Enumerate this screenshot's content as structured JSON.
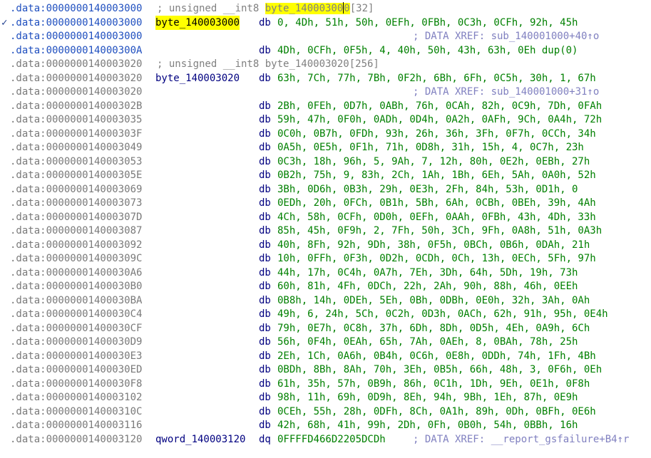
{
  "lines": [
    {
      "kind": "comment",
      "addr": ".data:0000000140003000",
      "text_pre": "; unsigned __int8 ",
      "hl": "byte_14000300",
      "hl_tail": "0",
      "text_post": "[32]",
      "addr_blue": true
    },
    {
      "kind": "data",
      "mark": "✓",
      "addr": ".data:0000000140003000",
      "label": "byte_140003000",
      "label_hl": true,
      "mnem": "db",
      "ops": "0, 4Dh, 51h, 50h, 0EFh, 0FBh, 0C3h, 0CFh, 92h, 45h",
      "addr_blue": true
    },
    {
      "kind": "xref",
      "addr": ".data:0000000140003000",
      "xref": "; DATA XREF: sub_140001000+40↑o",
      "addr_blue": true
    },
    {
      "kind": "data",
      "addr": ".data:000000014000300A",
      "mnem": "db",
      "ops": "4Dh, 0CFh, 0F5h, 4, 40h, 50h, 43h, 63h, 0Eh dup(0)",
      "addr_blue": true
    },
    {
      "kind": "comment",
      "addr": ".data:0000000140003020",
      "text_pre": "; unsigned __int8 byte_140003020[256]"
    },
    {
      "kind": "data",
      "addr": ".data:0000000140003020",
      "label": "byte_140003020",
      "mnem": "db",
      "ops": "63h, 7Ch, 77h, 7Bh, 0F2h, 6Bh, 6Fh, 0C5h, 30h, 1, 67h"
    },
    {
      "kind": "xref",
      "addr": ".data:0000000140003020",
      "xref": "; DATA XREF: sub_140001000+31↑o"
    },
    {
      "kind": "data",
      "addr": ".data:000000014000302B",
      "mnem": "db",
      "ops": "2Bh, 0FEh, 0D7h, 0ABh, 76h, 0CAh, 82h, 0C9h, 7Dh, 0FAh"
    },
    {
      "kind": "data",
      "addr": ".data:0000000140003035",
      "mnem": "db",
      "ops": "59h, 47h, 0F0h, 0ADh, 0D4h, 0A2h, 0AFh, 9Ch, 0A4h, 72h"
    },
    {
      "kind": "data",
      "addr": ".data:000000014000303F",
      "mnem": "db",
      "ops": "0C0h, 0B7h, 0FDh, 93h, 26h, 36h, 3Fh, 0F7h, 0CCh, 34h"
    },
    {
      "kind": "data",
      "addr": ".data:0000000140003049",
      "mnem": "db",
      "ops": "0A5h, 0E5h, 0F1h, 71h, 0D8h, 31h, 15h, 4, 0C7h, 23h"
    },
    {
      "kind": "data",
      "addr": ".data:0000000140003053",
      "mnem": "db",
      "ops": "0C3h, 18h, 96h, 5, 9Ah, 7, 12h, 80h, 0E2h, 0EBh, 27h"
    },
    {
      "kind": "data",
      "addr": ".data:000000014000305E",
      "mnem": "db",
      "ops": "0B2h, 75h, 9, 83h, 2Ch, 1Ah, 1Bh, 6Eh, 5Ah, 0A0h, 52h"
    },
    {
      "kind": "data",
      "addr": ".data:0000000140003069",
      "mnem": "db",
      "ops": "3Bh, 0D6h, 0B3h, 29h, 0E3h, 2Fh, 84h, 53h, 0D1h, 0"
    },
    {
      "kind": "data",
      "addr": ".data:0000000140003073",
      "mnem": "db",
      "ops": "0EDh, 20h, 0FCh, 0B1h, 5Bh, 6Ah, 0CBh, 0BEh, 39h, 4Ah"
    },
    {
      "kind": "data",
      "addr": ".data:000000014000307D",
      "mnem": "db",
      "ops": "4Ch, 58h, 0CFh, 0D0h, 0EFh, 0AAh, 0FBh, 43h, 4Dh, 33h"
    },
    {
      "kind": "data",
      "addr": ".data:0000000140003087",
      "mnem": "db",
      "ops": "85h, 45h, 0F9h, 2, 7Fh, 50h, 3Ch, 9Fh, 0A8h, 51h, 0A3h"
    },
    {
      "kind": "data",
      "addr": ".data:0000000140003092",
      "mnem": "db",
      "ops": "40h, 8Fh, 92h, 9Dh, 38h, 0F5h, 0BCh, 0B6h, 0DAh, 21h"
    },
    {
      "kind": "data",
      "addr": ".data:000000014000309C",
      "mnem": "db",
      "ops": "10h, 0FFh, 0F3h, 0D2h, 0CDh, 0Ch, 13h, 0ECh, 5Fh, 97h"
    },
    {
      "kind": "data",
      "addr": ".data:00000001400030A6",
      "mnem": "db",
      "ops": "44h, 17h, 0C4h, 0A7h, 7Eh, 3Dh, 64h, 5Dh, 19h, 73h"
    },
    {
      "kind": "data",
      "addr": ".data:00000001400030B0",
      "mnem": "db",
      "ops": "60h, 81h, 4Fh, 0DCh, 22h, 2Ah, 90h, 88h, 46h, 0EEh"
    },
    {
      "kind": "data",
      "addr": ".data:00000001400030BA",
      "mnem": "db",
      "ops": "0B8h, 14h, 0DEh, 5Eh, 0Bh, 0DBh, 0E0h, 32h, 3Ah, 0Ah"
    },
    {
      "kind": "data",
      "addr": ".data:00000001400030C4",
      "mnem": "db",
      "ops": "49h, 6, 24h, 5Ch, 0C2h, 0D3h, 0ACh, 62h, 91h, 95h, 0E4h"
    },
    {
      "kind": "data",
      "addr": ".data:00000001400030CF",
      "mnem": "db",
      "ops": "79h, 0E7h, 0C8h, 37h, 6Dh, 8Dh, 0D5h, 4Eh, 0A9h, 6Ch"
    },
    {
      "kind": "data",
      "addr": ".data:00000001400030D9",
      "mnem": "db",
      "ops": "56h, 0F4h, 0EAh, 65h, 7Ah, 0AEh, 8, 0BAh, 78h, 25h"
    },
    {
      "kind": "data",
      "addr": ".data:00000001400030E3",
      "mnem": "db",
      "ops": "2Eh, 1Ch, 0A6h, 0B4h, 0C6h, 0E8h, 0DDh, 74h, 1Fh, 4Bh"
    },
    {
      "kind": "data",
      "addr": ".data:00000001400030ED",
      "mnem": "db",
      "ops": "0BDh, 8Bh, 8Ah, 70h, 3Eh, 0B5h, 66h, 48h, 3, 0F6h, 0Eh"
    },
    {
      "kind": "data",
      "addr": ".data:00000001400030F8",
      "mnem": "db",
      "ops": "61h, 35h, 57h, 0B9h, 86h, 0C1h, 1Dh, 9Eh, 0E1h, 0F8h"
    },
    {
      "kind": "data",
      "addr": ".data:0000000140003102",
      "mnem": "db",
      "ops": "98h, 11h, 69h, 0D9h, 8Eh, 94h, 9Bh, 1Eh, 87h, 0E9h"
    },
    {
      "kind": "data",
      "addr": ".data:000000014000310C",
      "mnem": "db",
      "ops": "0CEh, 55h, 28h, 0DFh, 8Ch, 0A1h, 89h, 0Dh, 0BFh, 0E6h"
    },
    {
      "kind": "data",
      "addr": ".data:0000000140003116",
      "mnem": "db",
      "ops": "42h, 68h, 41h, 99h, 2Dh, 0Fh, 0B0h, 54h, 0BBh, 16h"
    },
    {
      "kind": "data",
      "addr": ".data:0000000140003120",
      "label": "qword_140003120",
      "mnem": "dq",
      "ops": "0FFFFD466D2205DCDh",
      "xref": "; DATA XREF: __report_gsfailure+B4↑r"
    }
  ],
  "colors": {
    "address_gray": "#7a7a7a",
    "address_blue": "#1f4fbf",
    "label_navy": "#000080",
    "operand_green": "#008000",
    "comment_gray": "#808080",
    "xref_lavender": "#8080c0",
    "highlight_yellow": "#ffff00"
  }
}
